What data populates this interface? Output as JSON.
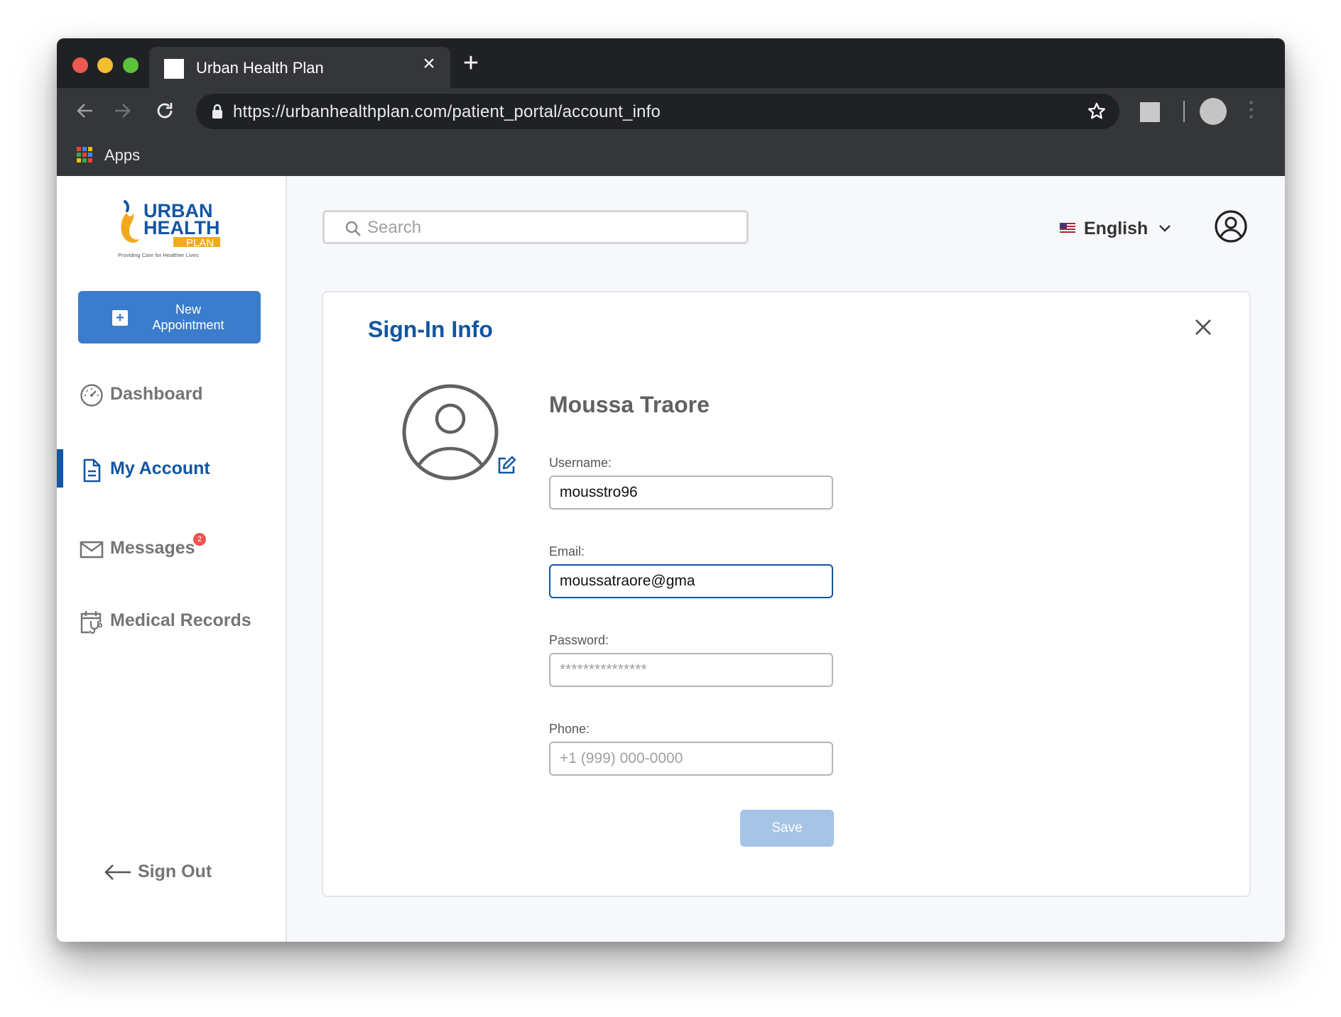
{
  "browser": {
    "tab_title": "Urban Health Plan",
    "url": "https://urbanhealthplan.com/patient_portal/account_info",
    "bookmarks_apps_label": "Apps"
  },
  "sidebar": {
    "logo": {
      "line1": "URBAN",
      "line2": "HEALTH",
      "line3": "PLAN",
      "tagline": "Providing Care for Healthier Lives"
    },
    "new_appointment_label": "New\nAppointment",
    "items": [
      {
        "label": "Dashboard",
        "icon": "gauge-icon",
        "active": false
      },
      {
        "label": "My Account",
        "icon": "document-icon",
        "active": true
      },
      {
        "label": "Messages",
        "icon": "envelope-icon",
        "active": false,
        "badge": "2"
      },
      {
        "label": "Medical Records",
        "icon": "medical-calendar-icon",
        "active": false
      }
    ],
    "sign_out_label": "Sign Out"
  },
  "header": {
    "search_placeholder": "Search",
    "language": "English"
  },
  "card": {
    "title": "Sign-In Info",
    "full_name": "Moussa Traore",
    "fields": {
      "username_label": "Username:",
      "username_value": "mousstro96",
      "email_label": "Email:",
      "email_value": "moussatraore@gma",
      "password_label": "Password:",
      "password_placeholder": "***************",
      "phone_label": "Phone:",
      "phone_placeholder": "+1 (999) 000-0000"
    },
    "save_label": "Save"
  },
  "colors": {
    "brand_blue": "#1356a2",
    "button_blue": "#3b7ccc",
    "save_disabled": "#a5c4e6",
    "badge_red": "#ef5350",
    "logo_orange": "#f2a91f"
  }
}
